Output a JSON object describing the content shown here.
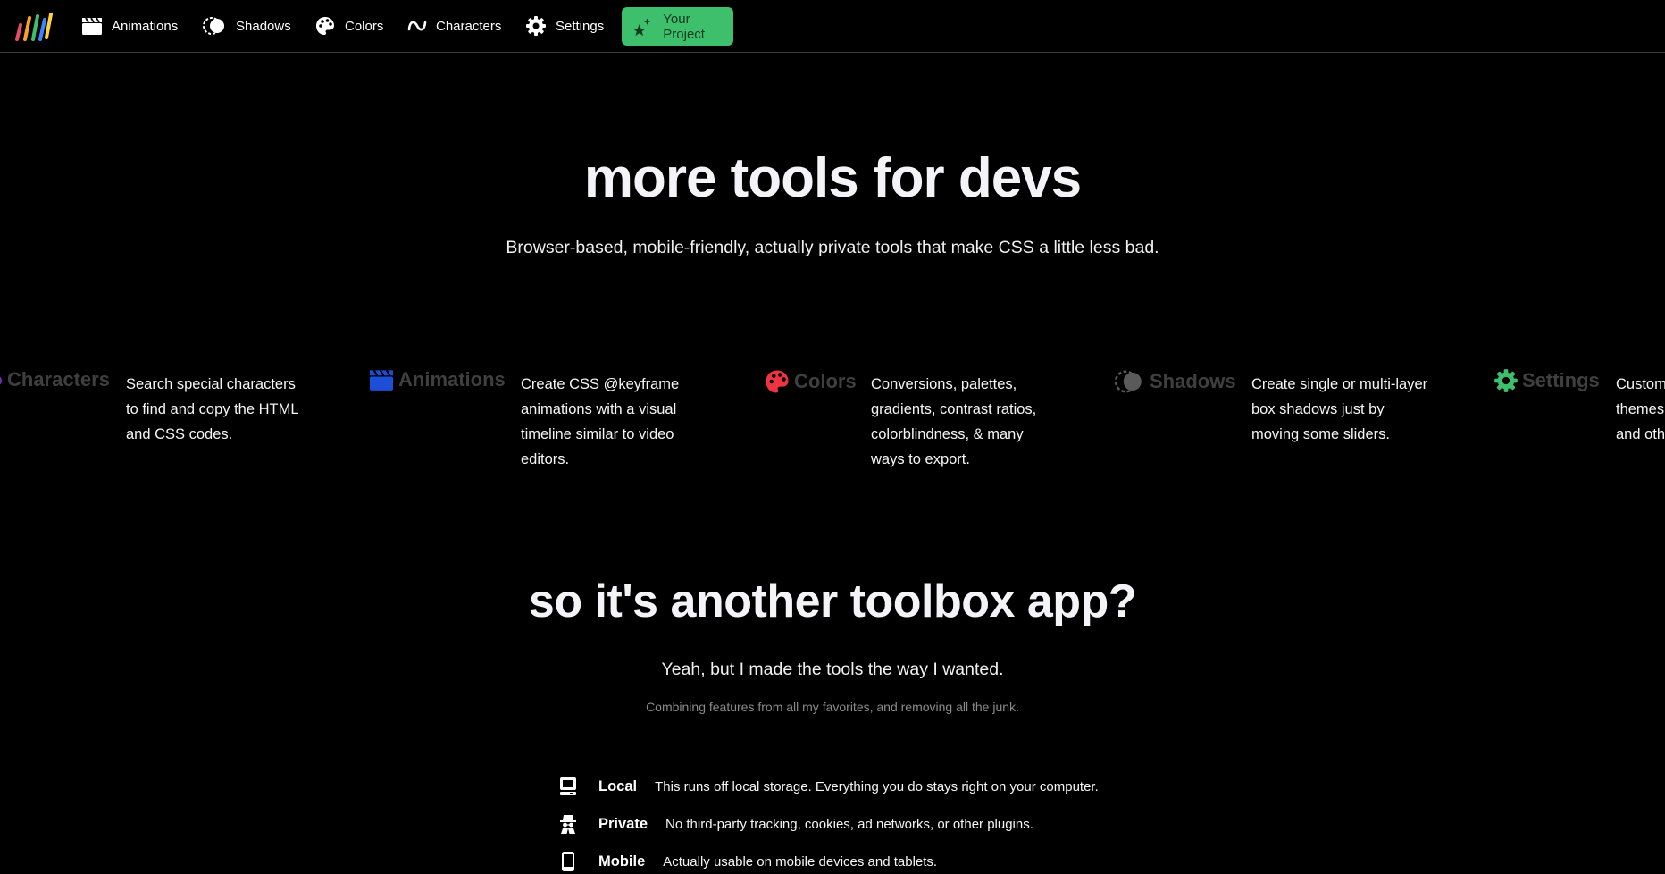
{
  "nav": {
    "items": [
      {
        "label": "Animations",
        "icon": "clapperboard-icon"
      },
      {
        "label": "Shadows",
        "icon": "shadow-icon"
      },
      {
        "label": "Colors",
        "icon": "palette-icon"
      },
      {
        "label": "Characters",
        "icon": "tilde-icon"
      },
      {
        "label": "Settings",
        "icon": "gear-icon"
      }
    ],
    "cta": {
      "label": "Your Project",
      "icon": "sparkle-star-icon",
      "color": "#3dbf6c"
    }
  },
  "hero": {
    "title": "more tools for devs",
    "subtitle": "Browser-based, mobile-friendly, actually private tools that make CSS a little less bad."
  },
  "tools": [
    {
      "title": "Characters",
      "icon_color": "#6a2dbf",
      "desc": [
        "Search special characters",
        "to find and copy the HTML",
        "and CSS codes."
      ]
    },
    {
      "title": "Animations",
      "icon_color": "#1d4ed8",
      "desc": [
        "Create CSS @keyframe",
        "animations with a visual",
        "timeline similar to video",
        "editors."
      ]
    },
    {
      "title": "Colors",
      "icon_color": "#ef3340",
      "desc": [
        "Conversions, palettes,",
        "gradients, contrast ratios,",
        "colorblindness, & many",
        "ways to export."
      ]
    },
    {
      "title": "Shadows",
      "icon_color": "#5a5a5a",
      "desc": [
        "Create single or multi-layer",
        "box shadows just by",
        "moving some sliders."
      ]
    },
    {
      "title": "Settings",
      "icon_color": "#3dbf6c",
      "desc": [
        "Custom",
        "themes",
        "and oth"
      ]
    }
  ],
  "section2": {
    "title": "so it's another toolbox app?",
    "subtitle": "Yeah, but I made the tools the way I wanted.",
    "note": "Combining features from all my favorites, and removing all the junk.",
    "features": [
      {
        "name": "Local",
        "desc": "This runs off local storage. Everything you do stays right on your computer.",
        "icon": "computer-icon"
      },
      {
        "name": "Private",
        "desc": "No third-party tracking, cookies, ad networks, or other plugins.",
        "icon": "spy-icon"
      },
      {
        "name": "Mobile",
        "desc": "Actually usable on mobile devices and tablets.",
        "icon": "mobile-icon"
      }
    ]
  }
}
